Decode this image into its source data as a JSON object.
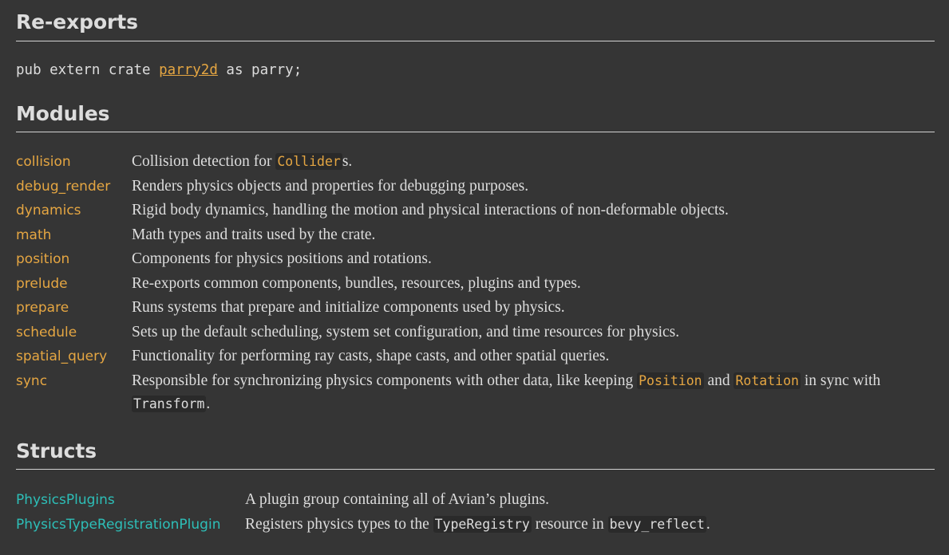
{
  "theme": {
    "background": "#353535",
    "text": "#dddddd",
    "rule": "#d2d2d2",
    "module_link": "#e5a642",
    "struct_link": "#2dbfb8",
    "code_background": "#2a2a2a",
    "code_text": "#dddddd",
    "code_link": "#e5a642"
  },
  "sections": {
    "reexports": {
      "heading": "Re-exports",
      "code": {
        "prefix": "pub extern crate ",
        "crate_name": "parry2d",
        "suffix": " as parry;"
      }
    },
    "modules": {
      "heading": "Modules",
      "items": [
        {
          "name": "collision",
          "desc_parts": [
            {
              "type": "text",
              "value": "Collision detection for "
            },
            {
              "type": "code-link",
              "value": "Collider"
            },
            {
              "type": "text",
              "value": "s."
            }
          ]
        },
        {
          "name": "debug_render",
          "desc_parts": [
            {
              "type": "text",
              "value": "Renders physics objects and properties for debugging purposes."
            }
          ]
        },
        {
          "name": "dynamics",
          "desc_parts": [
            {
              "type": "text",
              "value": "Rigid body dynamics, handling the motion and physical interactions of non-deformable objects."
            }
          ]
        },
        {
          "name": "math",
          "desc_parts": [
            {
              "type": "text",
              "value": "Math types and traits used by the crate."
            }
          ]
        },
        {
          "name": "position",
          "desc_parts": [
            {
              "type": "text",
              "value": "Components for physics positions and rotations."
            }
          ]
        },
        {
          "name": "prelude",
          "desc_parts": [
            {
              "type": "text",
              "value": "Re-exports common components, bundles, resources, plugins and types."
            }
          ]
        },
        {
          "name": "prepare",
          "desc_parts": [
            {
              "type": "text",
              "value": "Runs systems that prepare and initialize components used by physics."
            }
          ]
        },
        {
          "name": "schedule",
          "desc_parts": [
            {
              "type": "text",
              "value": "Sets up the default scheduling, system set configuration, and time resources for physics."
            }
          ]
        },
        {
          "name": "spatial_query",
          "desc_parts": [
            {
              "type": "text",
              "value": "Functionality for performing ray casts, shape casts, and other spatial queries."
            }
          ]
        },
        {
          "name": "sync",
          "desc_parts": [
            {
              "type": "text",
              "value": "Responsible for synchronizing physics components with other data, like keeping "
            },
            {
              "type": "code-link",
              "value": "Position"
            },
            {
              "type": "text",
              "value": " and "
            },
            {
              "type": "code-link",
              "value": "Rotation"
            },
            {
              "type": "text",
              "value": " in sync with "
            },
            {
              "type": "code",
              "value": "Transform"
            },
            {
              "type": "text",
              "value": "."
            }
          ]
        }
      ]
    },
    "structs": {
      "heading": "Structs",
      "items": [
        {
          "name": "PhysicsPlugins",
          "desc_parts": [
            {
              "type": "text",
              "value": "A plugin group containing all of Avian’s plugins."
            }
          ]
        },
        {
          "name": "PhysicsTypeRegistrationPlugin",
          "desc_parts": [
            {
              "type": "text",
              "value": "Registers physics types to the "
            },
            {
              "type": "code",
              "value": "TypeRegistry"
            },
            {
              "type": "text",
              "value": " resource in "
            },
            {
              "type": "code",
              "value": "bevy_reflect"
            },
            {
              "type": "text",
              "value": "."
            }
          ]
        }
      ]
    }
  }
}
